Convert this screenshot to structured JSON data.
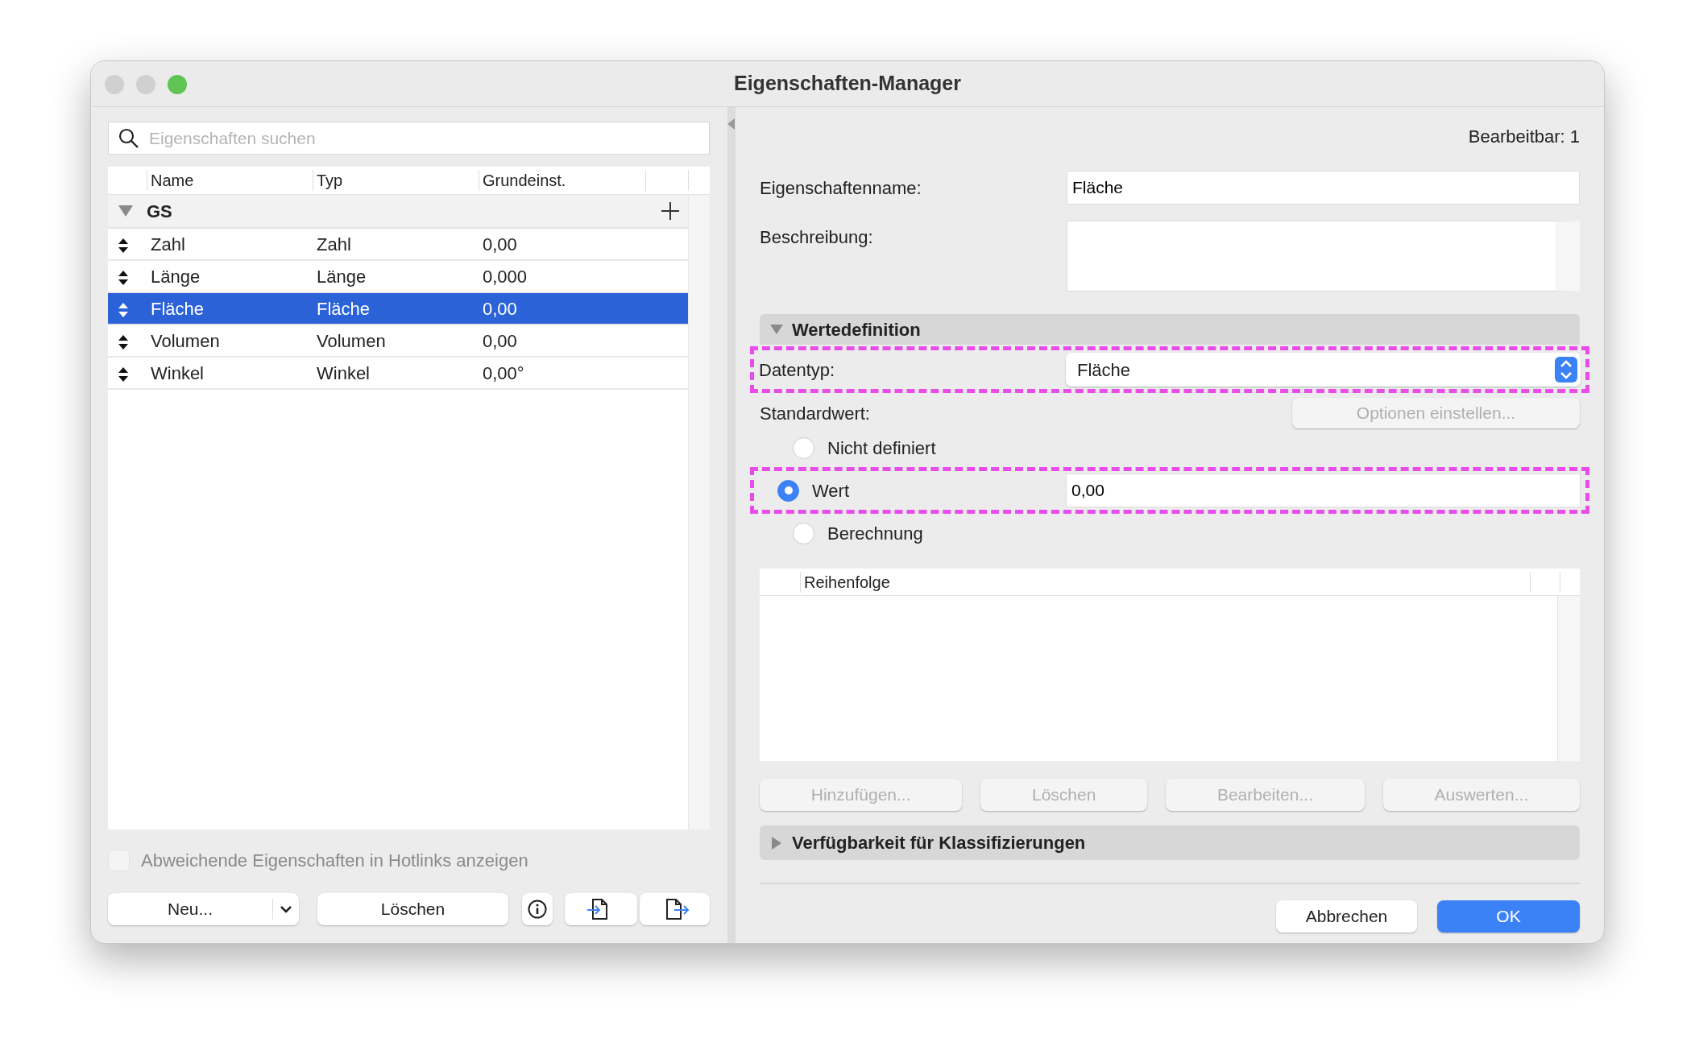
{
  "window": {
    "title": "Eigenschaften-Manager"
  },
  "left": {
    "search": {
      "placeholder": "Eigenschaften suchen"
    },
    "table": {
      "columns": [
        "Name",
        "Typ",
        "Grundeinst."
      ],
      "groups": [
        {
          "name": "GS",
          "expanded": true,
          "rows": [
            {
              "cells": [
                "Zahl",
                "Zahl",
                "0,00"
              ],
              "selected": false
            },
            {
              "cells": [
                "Länge",
                "Länge",
                "0,000"
              ],
              "selected": false
            },
            {
              "cells": [
                "Fläche",
                "Fläche",
                "0,00"
              ],
              "selected": true
            },
            {
              "cells": [
                "Volumen",
                "Volumen",
                "0,00"
              ],
              "selected": false
            },
            {
              "cells": [
                "Winkel",
                "Winkel",
                "0,00°"
              ],
              "selected": false
            }
          ]
        }
      ]
    },
    "hotlinks_checkbox": {
      "label": "Abweichende Eigenschaften in Hotlinks anzeigen",
      "checked": false,
      "disabled": true
    },
    "buttons": [
      {
        "kind": "split",
        "label": "Neu..."
      },
      {
        "kind": "text",
        "label": "Löschen"
      },
      {
        "kind": "info"
      },
      {
        "kind": "import"
      },
      {
        "kind": "export"
      }
    ]
  },
  "right": {
    "editable": "Bearbeitbar: 1",
    "name_field": {
      "label": "Eigenschaftenname:",
      "value": "Fläche"
    },
    "description_field": {
      "label": "Beschreibung:"
    },
    "value_definition": {
      "title": "Wertedefinition",
      "expanded": true,
      "datatype": {
        "label": "Datentyp:",
        "value": "Fläche",
        "highlighted": true
      },
      "default": {
        "label": "Standardwert:",
        "options_button": {
          "label": "Optionen einstellen...",
          "disabled": true
        },
        "options": [
          {
            "label": "Nicht definiert",
            "selected": false,
            "highlighted": false
          },
          {
            "label": "Wert",
            "selected": true,
            "value": "0,00",
            "highlighted": true
          },
          {
            "label": "Berechnung",
            "selected": false,
            "highlighted": false
          }
        ]
      },
      "order_table": {
        "columns": [
          "Reihenfolge"
        ]
      },
      "buttons": [
        {
          "label": "Hinzufügen...",
          "disabled": true
        },
        {
          "label": "Löschen",
          "disabled": true
        },
        {
          "label": "Bearbeiten...",
          "disabled": true
        },
        {
          "label": "Auswerten...",
          "disabled": true
        }
      ]
    },
    "classification": {
      "title": "Verfügbarkeit für Klassifizierungen",
      "expanded": false
    },
    "footer_buttons": [
      {
        "kind": "secondary",
        "label": "Abbrechen"
      },
      {
        "kind": "primary",
        "label": "OK"
      }
    ]
  }
}
